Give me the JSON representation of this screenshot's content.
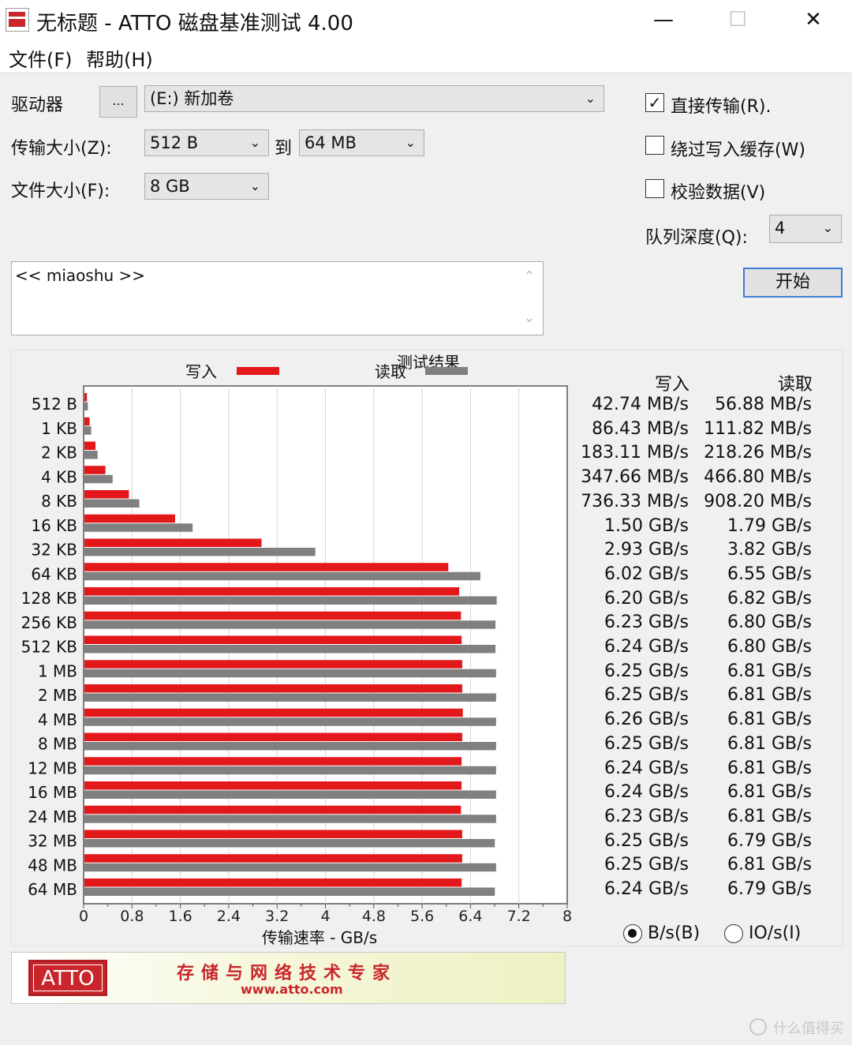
{
  "window": {
    "title": "无标题 - ATTO 磁盘基准测试 4.00",
    "minimize_glyph": "—",
    "maximize_glyph": "☐",
    "close_glyph": "✕"
  },
  "menu": {
    "file": "文件(F)",
    "help": "帮助(H)"
  },
  "settings": {
    "drive_label": "驱动器",
    "browse_label": "...",
    "drive_value": "(E:) 新加卷",
    "transfer_label": "传输大小(Z):",
    "transfer_from": "512 B",
    "transfer_to_label": "到",
    "transfer_to": "64 MB",
    "file_size_label": "文件大小(F):",
    "file_size": "8 GB",
    "direct_io_label": "直接传输(R).",
    "direct_io_checked": true,
    "bypass_cache_label": "绕过写入缓存(W)",
    "bypass_cache_checked": false,
    "verify_label": "校验数据(V)",
    "verify_checked": false,
    "queue_label": "队列深度(Q):",
    "queue_value": "4",
    "start_label": "开始"
  },
  "description": {
    "text": "<< miaoshu >>"
  },
  "results_panel": {
    "write_header": "写入",
    "read_header": "读取",
    "radio_bytes": "B/s(B)",
    "radio_io": "IO/s(I)",
    "bytes_selected": true,
    "rows": [
      {
        "size": "512 B",
        "write": "42.74 MB/s",
        "read": "56.88 MB/s"
      },
      {
        "size": "1 KB",
        "write": "86.43 MB/s",
        "read": "111.82 MB/s"
      },
      {
        "size": "2 KB",
        "write": "183.11 MB/s",
        "read": "218.26 MB/s"
      },
      {
        "size": "4 KB",
        "write": "347.66 MB/s",
        "read": "466.80 MB/s"
      },
      {
        "size": "8 KB",
        "write": "736.33 MB/s",
        "read": "908.20 MB/s"
      },
      {
        "size": "16 KB",
        "write": "1.50 GB/s",
        "read": "1.79 GB/s"
      },
      {
        "size": "32 KB",
        "write": "2.93 GB/s",
        "read": "3.82 GB/s"
      },
      {
        "size": "64 KB",
        "write": "6.02 GB/s",
        "read": "6.55 GB/s"
      },
      {
        "size": "128 KB",
        "write": "6.20 GB/s",
        "read": "6.82 GB/s"
      },
      {
        "size": "256 KB",
        "write": "6.23 GB/s",
        "read": "6.80 GB/s"
      },
      {
        "size": "512 KB",
        "write": "6.24 GB/s",
        "read": "6.80 GB/s"
      },
      {
        "size": "1 MB",
        "write": "6.25 GB/s",
        "read": "6.81 GB/s"
      },
      {
        "size": "2 MB",
        "write": "6.25 GB/s",
        "read": "6.81 GB/s"
      },
      {
        "size": "4 MB",
        "write": "6.26 GB/s",
        "read": "6.81 GB/s"
      },
      {
        "size": "8 MB",
        "write": "6.25 GB/s",
        "read": "6.81 GB/s"
      },
      {
        "size": "12 MB",
        "write": "6.24 GB/s",
        "read": "6.81 GB/s"
      },
      {
        "size": "16 MB",
        "write": "6.24 GB/s",
        "read": "6.81 GB/s"
      },
      {
        "size": "24 MB",
        "write": "6.23 GB/s",
        "read": "6.81 GB/s"
      },
      {
        "size": "32 MB",
        "write": "6.25 GB/s",
        "read": "6.79 GB/s"
      },
      {
        "size": "48 MB",
        "write": "6.25 GB/s",
        "read": "6.81 GB/s"
      },
      {
        "size": "64 MB",
        "write": "6.24 GB/s",
        "read": "6.79 GB/s"
      }
    ]
  },
  "banner": {
    "logo_text": "ATTO",
    "slogan": "存储与网络技术专家",
    "url": "www.atto.com"
  },
  "watermark": "什么值得买",
  "colors": {
    "write": "#e2181b",
    "read": "#808080",
    "accent": "#3c7fd6"
  },
  "chart_data": {
    "type": "bar",
    "orientation": "horizontal",
    "title": "测试结果",
    "xlabel": "传输速率 - GB/s",
    "ylabel": "",
    "xlim": [
      0,
      8
    ],
    "xticks": [
      "0",
      "0.8",
      "1.6",
      "2.4",
      "3.2",
      "4",
      "4.8",
      "5.6",
      "6.4",
      "7.2",
      "8"
    ],
    "grid": true,
    "legend": "top",
    "categories": [
      "512 B",
      "1 KB",
      "2 KB",
      "4 KB",
      "8 KB",
      "16 KB",
      "32 KB",
      "64 KB",
      "128 KB",
      "256 KB",
      "512 KB",
      "1 MB",
      "2 MB",
      "4 MB",
      "8 MB",
      "12 MB",
      "16 MB",
      "24 MB",
      "32 MB",
      "48 MB",
      "64 MB"
    ],
    "series": [
      {
        "name": "写入",
        "color": "#e2181b",
        "values": [
          0.04274,
          0.08643,
          0.18311,
          0.34766,
          0.73633,
          1.5,
          2.93,
          6.02,
          6.2,
          6.23,
          6.24,
          6.25,
          6.25,
          6.26,
          6.25,
          6.24,
          6.24,
          6.23,
          6.25,
          6.25,
          6.24
        ]
      },
      {
        "name": "读取",
        "color": "#808080",
        "values": [
          0.05688,
          0.11182,
          0.21826,
          0.4668,
          0.9082,
          1.79,
          3.82,
          6.55,
          6.82,
          6.8,
          6.8,
          6.81,
          6.81,
          6.81,
          6.81,
          6.81,
          6.81,
          6.81,
          6.79,
          6.81,
          6.79
        ]
      }
    ]
  }
}
